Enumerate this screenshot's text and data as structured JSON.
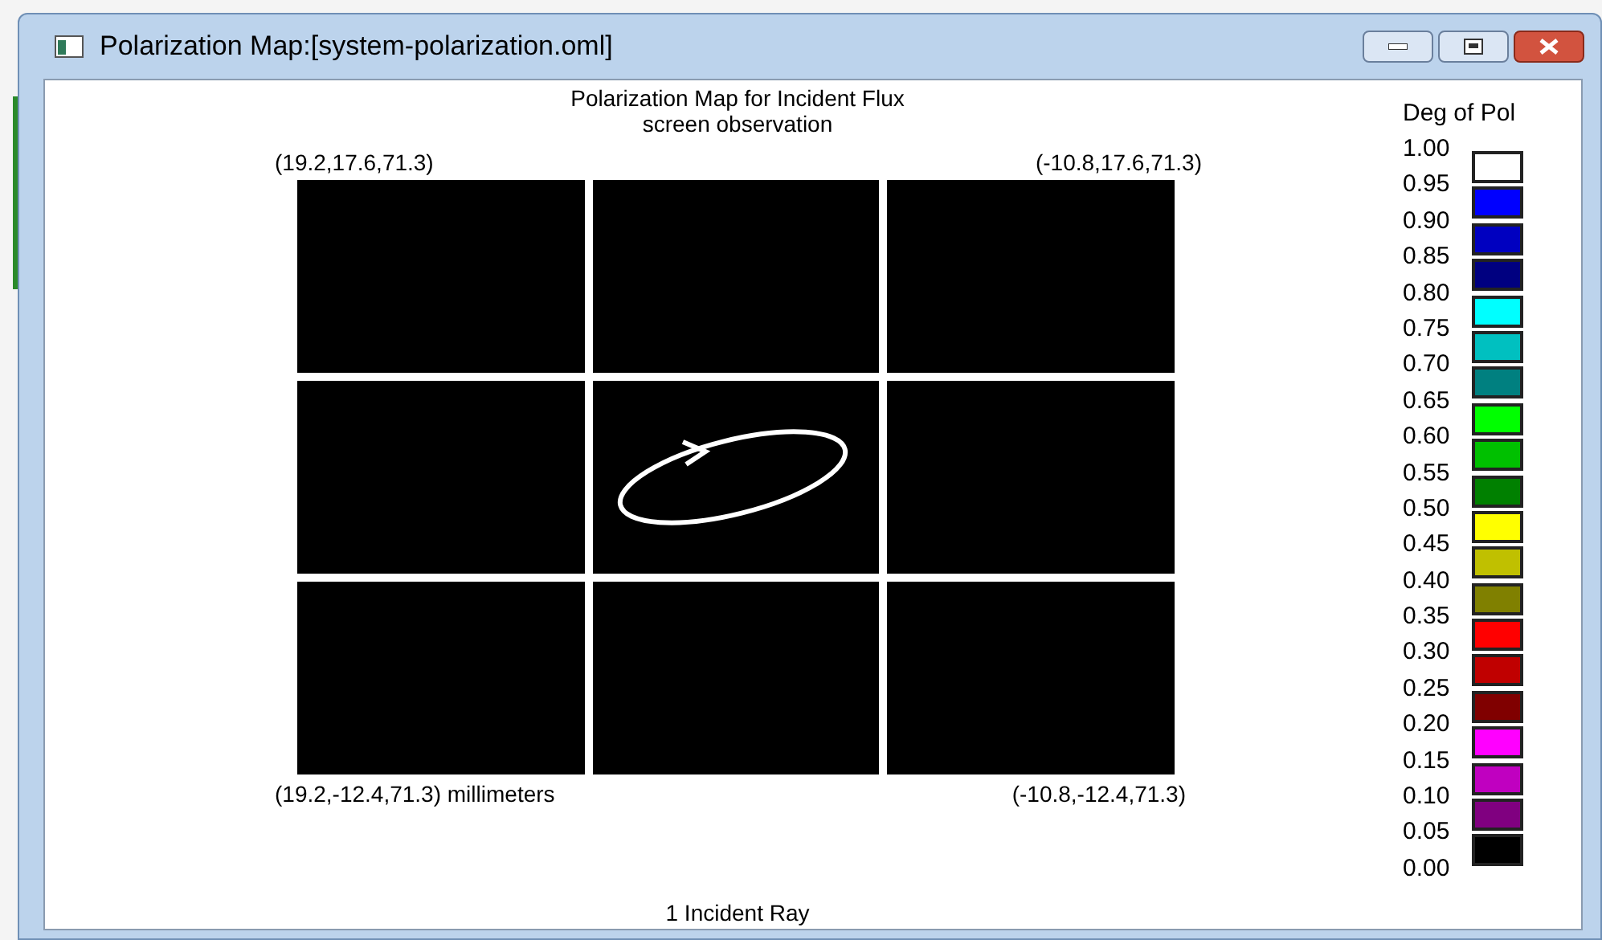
{
  "window": {
    "title": "Polarization Map:[system-polarization.oml]"
  },
  "plot": {
    "title": "Polarization Map for Incident Flux",
    "subtitle": "screen observation",
    "corner_top_left": "(19.2,17.6,71.3)",
    "corner_top_right": "(-10.8,17.6,71.3)",
    "corner_bottom_left": "(19.2,-12.4,71.3) millimeters",
    "corner_bottom_right": "(-10.8,-12.4,71.3)",
    "footer": "1 Incident Ray"
  },
  "legend": {
    "title": "Deg of Pol",
    "ticks": [
      "1.00",
      "0.95",
      "0.90",
      "0.85",
      "0.80",
      "0.75",
      "0.70",
      "0.65",
      "0.60",
      "0.55",
      "0.50",
      "0.45",
      "0.40",
      "0.35",
      "0.30",
      "0.25",
      "0.20",
      "0.15",
      "0.10",
      "0.05",
      "0.00"
    ],
    "swatches": [
      {
        "color": "#ffffff"
      },
      {
        "color": "#0000ff"
      },
      {
        "color": "#0000c0"
      },
      {
        "color": "#000080"
      },
      {
        "color": "#00ffff"
      },
      {
        "color": "#00c0c0"
      },
      {
        "color": "#008080"
      },
      {
        "color": "#00ff00"
      },
      {
        "color": "#00c000"
      },
      {
        "color": "#008000"
      },
      {
        "color": "#ffff00"
      },
      {
        "color": "#c0c000"
      },
      {
        "color": "#808000"
      },
      {
        "color": "#ff0000"
      },
      {
        "color": "#c00000"
      },
      {
        "color": "#800000"
      },
      {
        "color": "#ff00ff"
      },
      {
        "color": "#c000c0"
      },
      {
        "color": "#800080"
      },
      {
        "color": "#000000"
      }
    ]
  }
}
